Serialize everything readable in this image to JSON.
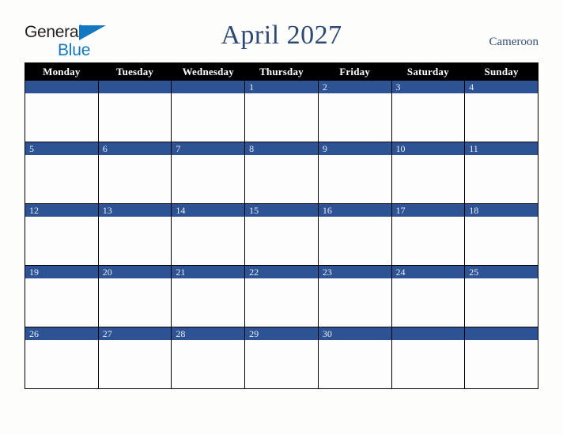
{
  "logo": {
    "word1": "General",
    "word2": "Blue",
    "triangle_color": "#1378bf",
    "word1_color": "#231f20",
    "word2_color": "#1378bf"
  },
  "header": {
    "title": "April 2027",
    "country": "Cameroon",
    "title_color": "#2e4a73",
    "country_color": "#2e4a73"
  },
  "calendar": {
    "accent_color": "#2e5395",
    "header_bg": "#000000",
    "header_fg": "#ffffff",
    "cell_bg": "#fdfdfd",
    "day_headers": [
      "Monday",
      "Tuesday",
      "Wednesday",
      "Thursday",
      "Friday",
      "Saturday",
      "Sunday"
    ],
    "weeks": [
      [
        "",
        "",
        "",
        "1",
        "2",
        "3",
        "4"
      ],
      [
        "5",
        "6",
        "7",
        "8",
        "9",
        "10",
        "11"
      ],
      [
        "12",
        "13",
        "14",
        "15",
        "16",
        "17",
        "18"
      ],
      [
        "19",
        "20",
        "21",
        "22",
        "23",
        "24",
        "25"
      ],
      [
        "26",
        "27",
        "28",
        "29",
        "30",
        "",
        ""
      ]
    ]
  }
}
